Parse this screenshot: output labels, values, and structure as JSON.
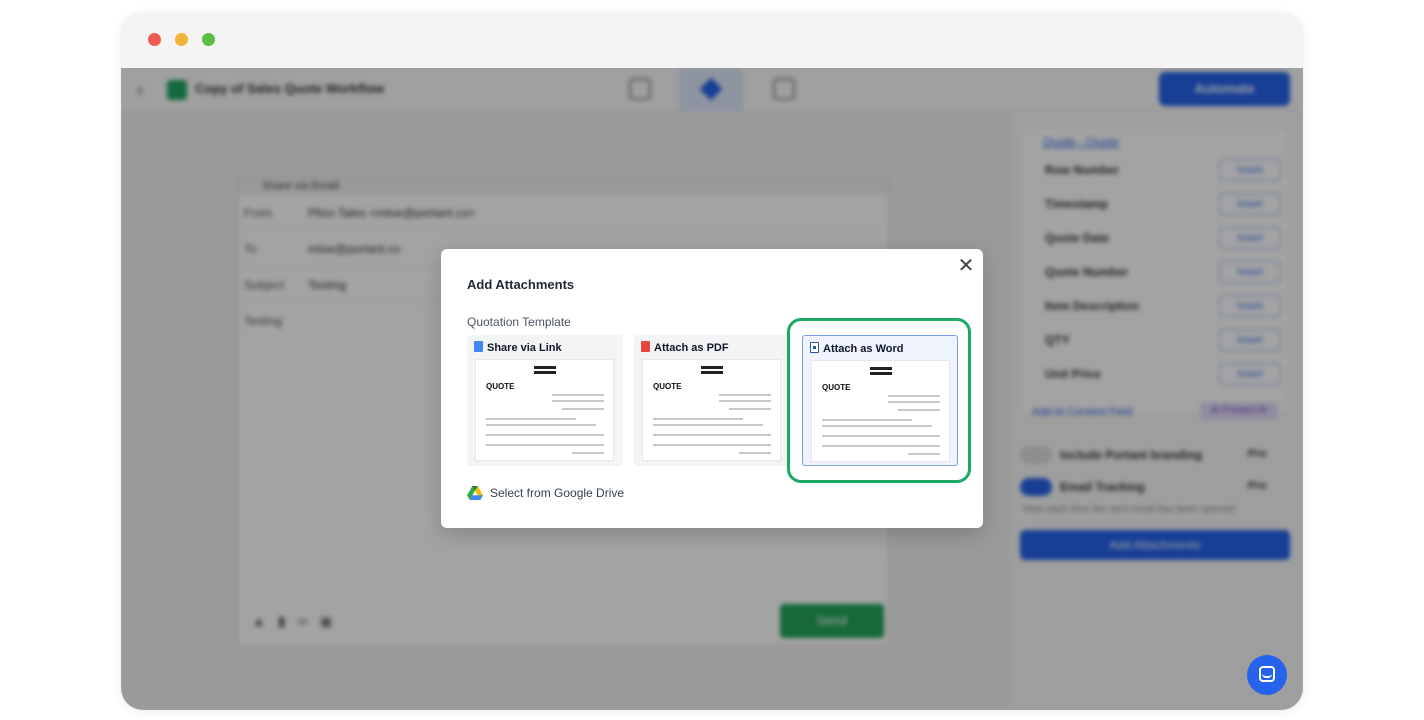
{
  "app": {
    "workflow_title": "Copy of Sales Quote Workflow",
    "automate_label": "Automate"
  },
  "email": {
    "header": "Share via Email",
    "from_label": "From",
    "from_value": "Pfizo Tales <mtoe@portant.co>",
    "to_label": "To",
    "to_value": "mtoe@portant.co",
    "subject_label": "Subject",
    "subject_value": "Testing",
    "body": "Testing",
    "send_label": "Send"
  },
  "right_panel": {
    "source_link": "Quote - Quote",
    "items": [
      {
        "label": "Row Number"
      },
      {
        "label": "Timestamp"
      },
      {
        "label": "Quote Date"
      },
      {
        "label": "Quote Number"
      },
      {
        "label": "Item Description"
      },
      {
        "label": "QTY"
      },
      {
        "label": "Unit Price"
      }
    ],
    "insert_label": "Insert",
    "add_field": "Add AI Content Field",
    "ai_badge": "AI Portant AI",
    "branding_label": "Include Portant branding",
    "tracking_label": "Email Tracking",
    "pro_label": "Pro",
    "tracking_sub": "View each time the sent email has been opened",
    "add_attachments_btn": "Add Attachments"
  },
  "modal": {
    "title": "Add Attachments",
    "section_label": "Quotation Template",
    "options": [
      {
        "label": "Share via Link",
        "icon": "google-doc-icon"
      },
      {
        "label": "Attach as PDF",
        "icon": "pdf-icon"
      },
      {
        "label": "Attach as Word",
        "icon": "word-icon"
      }
    ],
    "thumbnail_title": "QUOTE",
    "google_drive_label": "Select from Google Drive",
    "selected_option": "Attach as Word"
  },
  "colors": {
    "accent": "#2563eb",
    "highlight": "#1ea866",
    "send": "#22a55b"
  }
}
